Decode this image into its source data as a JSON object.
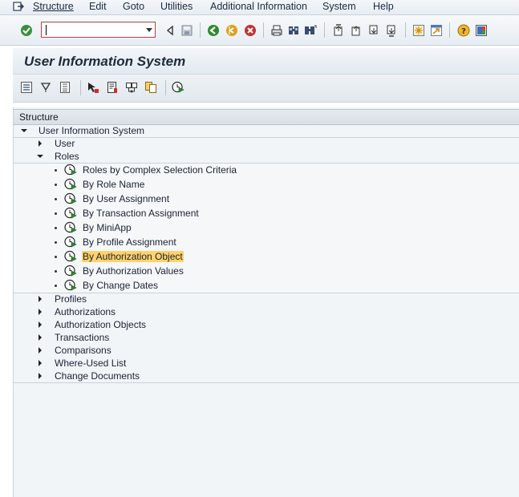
{
  "menu": {
    "items": [
      {
        "label": "Structure"
      },
      {
        "label": "Edit"
      },
      {
        "label": "Goto"
      },
      {
        "label": "Utilities"
      },
      {
        "label": "Additional Information"
      },
      {
        "label": "System"
      },
      {
        "label": "Help"
      }
    ]
  },
  "command_field": {
    "value": ""
  },
  "title": "User Information System",
  "tree": {
    "header": "Structure",
    "root": "User Information System",
    "nodes": {
      "user": "User",
      "roles": "Roles",
      "profiles": "Profiles",
      "authorizations": "Authorizations",
      "authorization_objects": "Authorization Objects",
      "transactions": "Transactions",
      "comparisons": "Comparisons",
      "where_used": "Where-Used List",
      "change_documents": "Change Documents"
    },
    "role_children": [
      "Roles by Complex Selection Criteria",
      "By Role Name",
      "By User Assignment",
      "By Transaction Assignment",
      "By MiniApp",
      "By Profile Assignment",
      "By Authorization Object",
      "By Authorization Values",
      "By Change Dates"
    ],
    "selected": "By Authorization Object"
  },
  "colors": {
    "highlight": "#ffd36a",
    "execute_icon": "#2e8b2e"
  },
  "icons": {
    "leaf": "execute-clock-icon"
  }
}
